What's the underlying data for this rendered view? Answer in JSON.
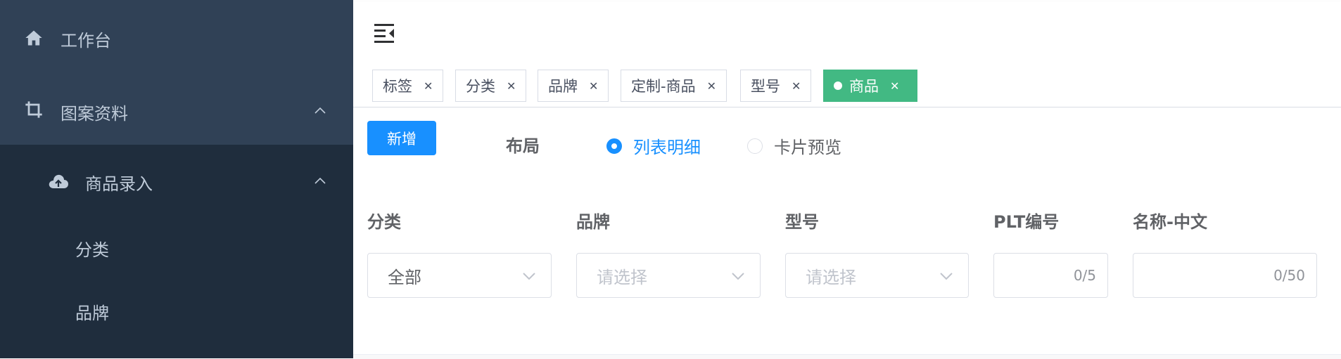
{
  "sidebar": {
    "items": [
      {
        "label": "工作台",
        "icon": "home-icon"
      },
      {
        "label": "图案资料",
        "icon": "crop-icon",
        "expanded": true
      },
      {
        "label": "商品录入",
        "icon": "cloud-upload-icon",
        "expanded": true
      },
      {
        "label": "分类"
      },
      {
        "label": "品牌"
      }
    ]
  },
  "navbar": {
    "toggle_icon": "menu-fold-icon"
  },
  "tags": [
    {
      "label": "标签",
      "active": false
    },
    {
      "label": "分类",
      "active": false
    },
    {
      "label": "品牌",
      "active": false
    },
    {
      "label": "定制-商品",
      "active": false
    },
    {
      "label": "型号",
      "active": false
    },
    {
      "label": "商品",
      "active": true
    }
  ],
  "toolbar": {
    "add_label": "新增",
    "layout_label": "布局",
    "layout_options": [
      {
        "label": "列表明细",
        "checked": true
      },
      {
        "label": "卡片预览",
        "checked": false
      }
    ]
  },
  "filters": {
    "category": {
      "label": "分类",
      "value": "全部"
    },
    "brand": {
      "label": "品牌",
      "placeholder": "请选择"
    },
    "model": {
      "label": "型号",
      "placeholder": "请选择"
    },
    "plt": {
      "label": "PLT编号",
      "count": "0/5"
    },
    "name_cn": {
      "label": "名称-中文",
      "count": "0/50"
    }
  },
  "colors": {
    "sidebar_bg": "#1f2d3d",
    "sidebar_top_bg": "#304156",
    "sidebar_text": "#bfcbd9",
    "primary": "#1890ff",
    "tag_active": "#42b983"
  }
}
